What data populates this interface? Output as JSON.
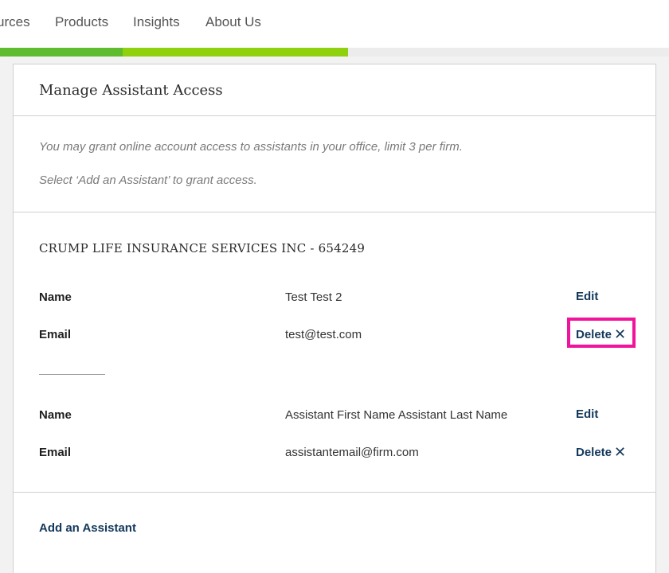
{
  "nav": {
    "items": [
      "urces",
      "Products",
      "Insights",
      "About Us"
    ]
  },
  "progress": {
    "colors": [
      "#5fbc2e",
      "#8fd10f"
    ]
  },
  "header": {
    "title": "Manage Assistant Access"
  },
  "info": {
    "line1": "You may grant online account access to assistants in your office, limit 3 per firm.",
    "line2": "Select ‘Add an Assistant’ to grant access."
  },
  "firm": {
    "name": "CRUMP LIFE INSURANCE SERVICES INC - 654249"
  },
  "labels": {
    "name": "Name",
    "email": "Email",
    "edit": "Edit",
    "delete": "Delete",
    "delete_icon": "close-icon"
  },
  "assistants": [
    {
      "name": "Test Test 2",
      "email": "test@test.com"
    },
    {
      "name": "Assistant First Name Assistant Last Name",
      "email": "assistantemail@firm.com"
    }
  ],
  "footer": {
    "add_label": "Add an Assistant"
  },
  "colors": {
    "highlight": "#f0139c",
    "link": "#13385b"
  }
}
